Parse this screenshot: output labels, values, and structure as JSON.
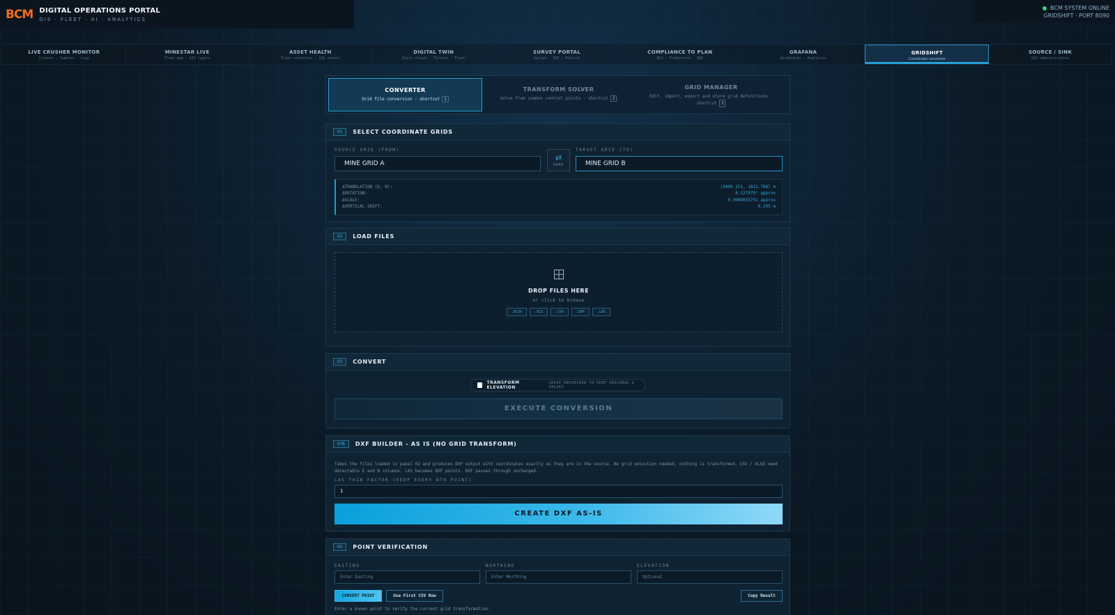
{
  "brand": {
    "logo": "BCM",
    "title": "DIGITAL OPERATIONS PORTAL",
    "subtitle": "GIS · FLEET · AI · ANALYTICS"
  },
  "system_status": {
    "label": "BCM SYSTEM ONLINE",
    "port": "GRIDSHIFT · PORT 8090",
    "color": "#3ed177"
  },
  "nav": {
    "tabs": [
      {
        "label": "LIVE CRUSHER MONITOR",
        "sub": "Crusher · Samples · Logs"
      },
      {
        "label": "MINESTAR LIVE",
        "sub": "Fleet map · GIS layers"
      },
      {
        "label": "ASSET HEALTH",
        "sub": "Fleet condition · GIS events"
      },
      {
        "label": "DIGITAL TWIN",
        "sub": "Point clouds · Terrain · Fleet"
      },
      {
        "label": "SURVEY PORTAL",
        "sub": "Upload · SOP · Publish"
      },
      {
        "label": "COMPLIANCE TO PLAN",
        "sub": "BCS · Production · DRE"
      },
      {
        "label": "GRAFANA",
        "sub": "Dashboards · Analytics"
      },
      {
        "label": "GRIDSHIFT",
        "sub": "Coordinate converter"
      },
      {
        "label": "SOURCE / SINK",
        "sub": "GIS administration"
      }
    ]
  },
  "tool_tabs": [
    {
      "label": "CONVERTER",
      "sub": "Grid file conversion · shortcut",
      "key": "1"
    },
    {
      "label": "TRANSFORM SOLVER",
      "sub": "Solve from common control points · shortcut",
      "key": "2"
    },
    {
      "label": "GRID MANAGER",
      "sub": "Edit, import, export and store grid definitions · shortcut",
      "key": "3"
    }
  ],
  "panel_grids": {
    "badge": "01",
    "title": "SELECT COORDINATE GRIDS",
    "source_label": "SOURCE GRID (FROM)",
    "source_value": "MINE GRID A",
    "target_label": "TARGET GRID (TO)",
    "target_value": "MINE GRID B",
    "swap_label": "SWAP",
    "params": [
      {
        "key": "ΔTRANSLATION (E, N):",
        "value": "(9499.251, 1812.798) m"
      },
      {
        "key": "ΔROTATION:",
        "value": "0.127979° approx"
      },
      {
        "key": "ΔSCALE:",
        "value": "0.9999833751 approx"
      },
      {
        "key": "ΔVERTICAL SHIFT:",
        "value": "0.295 m"
      }
    ]
  },
  "panel_files": {
    "badge": "02",
    "title": "LOAD FILES",
    "drop_title": "DROP FILES HERE",
    "drop_sub": "or click to browse",
    "extensions": [
      ".XLSX",
      ".XLS",
      ".CSV",
      ".DXF",
      ".LAS"
    ]
  },
  "panel_convert": {
    "badge": "03",
    "title": "CONVERT",
    "elevation_label": "TRANSFORM ELEVATION",
    "elevation_hint": "LEAVE UNCHECKED TO KEEP ORIGINAL Z VALUES",
    "execute_label": "EXECUTE CONVERSION"
  },
  "panel_dxf": {
    "badge": "03B",
    "title": "DXF BUILDER - AS IS (NO GRID TRANSFORM)",
    "description": "Takes the files loaded in panel 02 and produces DXF output with coordinates exactly as they are in the source. No grid selection needed, nothing is transformed. CSV / XLSX need detectable E and N columns. LAS becomes DXF points. DXF passes through unchanged.",
    "thin_label": "LAS THIN FACTOR (KEEP EVERY NTH POINT)",
    "thin_value": "1",
    "button_label": "CREATE DXF AS-IS"
  },
  "panel_verify": {
    "badge": "05",
    "title": "POINT VERIFICATION",
    "easting_label": "EASTING",
    "easting_placeholder": "Enter Easting",
    "northing_label": "NORTHING",
    "northing_placeholder": "Enter Northing",
    "elevation_label": "ELEVATION",
    "elevation_placeholder": "Optional",
    "convert_label": "CONVERT POINT",
    "csv_label": "Use First CSV Row",
    "copy_label": "Copy Result",
    "note": "Enter a known point to verify the current grid transformation."
  }
}
